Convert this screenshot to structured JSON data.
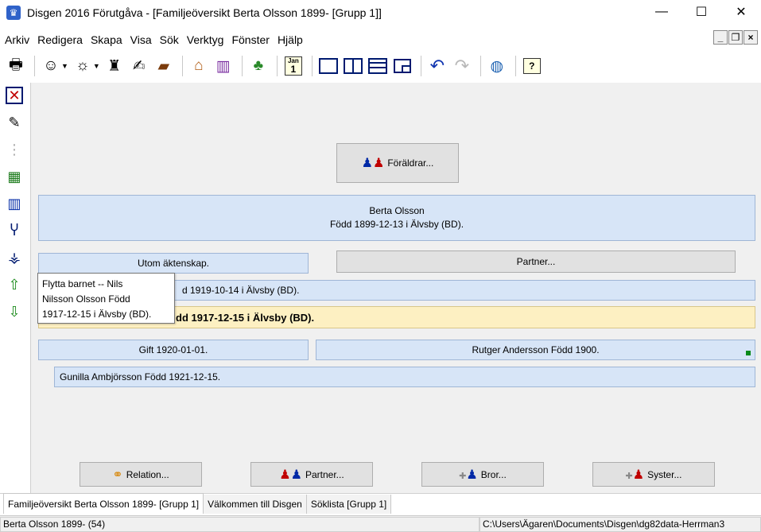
{
  "window": {
    "title": "Disgen 2016 Förutgåva - [Familjeöversikt Berta Olsson 1899- [Grupp 1]]",
    "app_icon": "disgen-icon",
    "minimize": "—",
    "maximize": "☐",
    "close": "✕"
  },
  "menu": [
    "Arkiv",
    "Redigera",
    "Skapa",
    "Visa",
    "Sök",
    "Verktyg",
    "Fönster",
    "Hjälp"
  ],
  "mdi": {
    "min": "_",
    "restore": "❐",
    "close": "×"
  },
  "toolbar": {
    "calendar_top": "Jan",
    "calendar_day": "1"
  },
  "family": {
    "parents_button": "Föräldrar...",
    "person": {
      "name": "Berta Olsson",
      "born": "Född 1899-12-13 i Älvsby (BD)."
    },
    "outside_marriage_label": "Utom äktenskap.",
    "partner_button": "Partner...",
    "child1": "d 1919-10-14 i Älvsby (BD).",
    "child2": "dd 1917-12-15 i Älvsby (BD).",
    "marriage_label": "Gift 1920-01-01.",
    "spouse": "Rutger Andersson Född 1900.",
    "child3": "Gunilla Ambjörsson Född 1921-12-15."
  },
  "tooltip": {
    "line1": "Flytta barnet -- Nils",
    "line2": "Nilsson Olsson Född",
    "line3": "1917-12-15 i Älvsby (BD)."
  },
  "bottom_buttons": {
    "relation": "Relation...",
    "partner": "Partner...",
    "brother": "Bror...",
    "sister": "Syster..."
  },
  "tabs": [
    "Familjeöversikt Berta Olsson 1899- [Grupp 1]",
    "Välkommen till Disgen",
    "Söklista [Grupp 1]"
  ],
  "status": {
    "left": "Berta Olsson 1899- (54)",
    "right": "C:\\Users\\Ägaren\\Documents\\Disgen\\dg82data-Herrman3"
  },
  "colors": {
    "panel_blue": "#d7e5f7",
    "highlight_yellow": "#fdf0c2",
    "male_blue": "#0029a6",
    "female_red": "#c00000"
  }
}
